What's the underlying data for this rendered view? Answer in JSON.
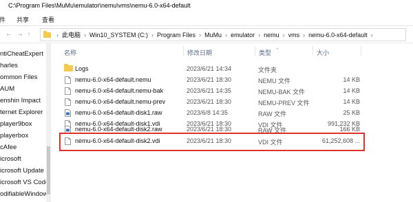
{
  "titlebar": {
    "path": "C:\\Program Files\\MuMu\\emulator\\nemu\\vms\\nemu-6.0-x64-default"
  },
  "ribbon": {
    "tabs": [
      "件",
      "共享",
      "查看"
    ]
  },
  "address": {
    "crumbs": [
      "此电脑",
      "Win10_SYSTEM (C:)",
      "Program Files",
      "MuMu",
      "emulator",
      "nemu",
      "vms",
      "nemu-6.0-x64-default"
    ]
  },
  "sidebar": {
    "items": [
      "ntiCheatExpert",
      "harles",
      "ommon Files",
      "AUM",
      "enshin Impact",
      "ternet Explorer",
      "player9box",
      "playerbox",
      "cAfee",
      "icrosoft",
      "icrosoft Update",
      "icrosoft VS Code",
      "odifiableWindow"
    ]
  },
  "columns": {
    "name": "名称",
    "date": "修改日期",
    "type": "类型",
    "size": "大小"
  },
  "files": [
    {
      "name": "Logs",
      "date": "2023/6/21 14:34",
      "type": "文件夹",
      "size": "",
      "icon": "folder-icon"
    },
    {
      "name": "nemu-6.0-x64-default.nemu",
      "date": "2023/6/21 18:30",
      "type": "NEMU 文件",
      "size": "14 KB",
      "icon": "file-icon"
    },
    {
      "name": "nemu-6.0-x64-default.nemu-bak",
      "date": "2023/6/21 14:35",
      "type": "NEMU-BAK 文件",
      "size": "14 KB",
      "icon": "file-icon"
    },
    {
      "name": "nemu-6.0-x64-default.nemu-prev",
      "date": "2023/6/21 18:30",
      "type": "NEMU-PREV 文件",
      "size": "14 KB",
      "icon": "file-icon"
    },
    {
      "name": "nemu-6.0-x64-default-disk1.raw",
      "date": "2023/6/8 14:35",
      "type": "RAW 文件",
      "size": "25 KB",
      "icon": "raw-file-icon"
    },
    {
      "name": "nemu-6.0-x64-default-disk1.vdi",
      "date": "2023/6/21 18:30",
      "type": "VDI 文件",
      "size": "991,232 KB",
      "icon": "file-icon"
    },
    {
      "name": "nemu-6.0-x64-default-disk2.raw",
      "date": "2023/6/21 18:30",
      "type": "RAW 文件",
      "size": "166 KB",
      "icon": "raw-file-icon"
    },
    {
      "name": "nemu-6.0-x64-default-disk2.vdi",
      "date": "2023/6/21 18:30",
      "type": "VDI 文件",
      "size": "61,252,608 ...",
      "icon": "file-icon"
    }
  ],
  "colors": {
    "highlight": "#e0302a",
    "folder": "#f5c94a",
    "header_text": "#5a6a85"
  }
}
